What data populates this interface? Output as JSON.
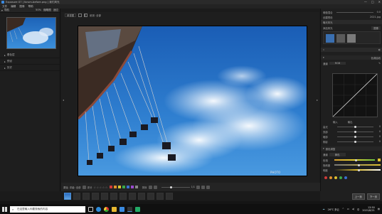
{
  "window": {
    "title": "Exposure X7 | forum-before.png [ 我们风光",
    "controls": [
      "—",
      "□",
      "✕"
    ]
  },
  "menu": [
    "文件",
    "编辑",
    "图像",
    "帮助"
  ],
  "left_panel": {
    "header_label": "导航",
    "header_right": [
      "50%",
      "缩略图",
      "适应"
    ],
    "sections": [
      "着色层",
      "预设",
      "历史"
    ]
  },
  "center_toolbar": {
    "items": [
      "单视图",
      "纸张: 全部"
    ]
  },
  "right_panel": {
    "top_rows": [
      {
        "label": "阈值混合",
        "value": "0.0"
      },
      {
        "label": "创建预设",
        "value": "2021.jpg"
      },
      {
        "label": "曝光风光",
        "value": ""
      }
    ],
    "preset_label": "添加风光",
    "preset_value": "图像",
    "curves_header": "色调曲线",
    "channel_label": "通道",
    "channel_value": "RGB",
    "input_label": "输入",
    "output_label": "输出",
    "slider_labels": [
      "高光",
      "亮部",
      "暗部",
      "阴影"
    ],
    "slider_values": [
      "0",
      "0",
      "0",
      "0"
    ],
    "hsl_header": "颜色调整",
    "hsl_channel_label": "通道",
    "hsl_channel_value": "黄色",
    "hsl_sliders": [
      "色相",
      "饱和度",
      "明度"
    ]
  },
  "bottom_toolbar": {
    "labels": [
      "原始",
      "评级: 全部",
      "评分",
      "排序"
    ],
    "zoom": "1/1",
    "swatches": [
      "#d03a3a",
      "#e0902b",
      "#d8c632",
      "#3aa84a",
      "#3a6fd0",
      "#9a4ad0",
      "#888888"
    ]
  },
  "filmstrip": {
    "buttons": [
      "上一页",
      "下一页"
    ]
  },
  "taskbar": {
    "search_placeholder": "在这里输入你要搜索的内容",
    "weather": "26°C 多云",
    "time": "13:50",
    "date": "2021/8/21",
    "language": "中"
  },
  "colors": {
    "accent": "#4a8fd8",
    "panel_bg": "#1e1e1e",
    "sky": "#2f7fd0"
  }
}
